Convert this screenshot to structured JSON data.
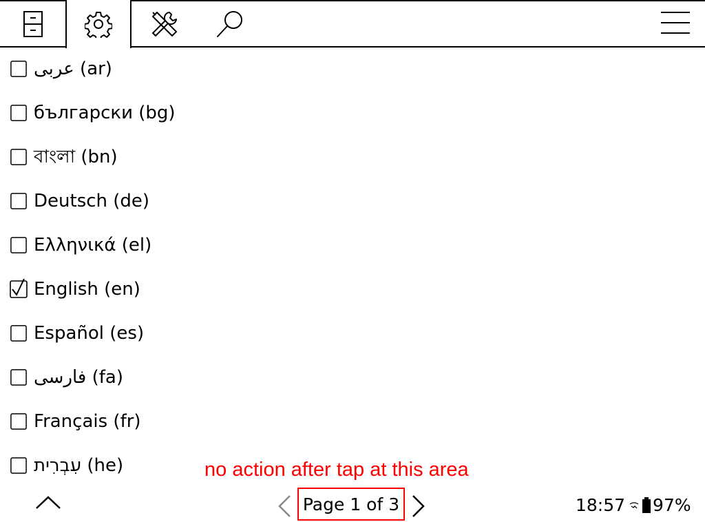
{
  "tabs": [
    {
      "id": "filemanager",
      "icon": "file-cabinet-icon",
      "active": false
    },
    {
      "id": "settings",
      "icon": "gear-icon",
      "active": true
    },
    {
      "id": "tools",
      "icon": "tools-icon",
      "active": false
    },
    {
      "id": "search",
      "icon": "search-icon",
      "active": false
    }
  ],
  "menu_icon": "hamburger-menu-icon",
  "languages": [
    {
      "label": "عربى (ar)",
      "checked": false
    },
    {
      "label": "български (bg)",
      "checked": false
    },
    {
      "label": "বাংলা (bn)",
      "checked": false
    },
    {
      "label": "Deutsch (de)",
      "checked": false
    },
    {
      "label": "Ελληνικά (el)",
      "checked": false
    },
    {
      "label": "English (en)",
      "checked": true
    },
    {
      "label": "Español (es)",
      "checked": false
    },
    {
      "label": "فارسی (fa)",
      "checked": false
    },
    {
      "label": "Français (fr)",
      "checked": false
    },
    {
      "label": "עִבְרִית (he)",
      "checked": false
    }
  ],
  "annotation": {
    "text": "no action after tap at this area",
    "color": "#ff0000"
  },
  "footer": {
    "page_indicator": "Page 1 of 3",
    "time": "18:57",
    "battery": "97%"
  }
}
